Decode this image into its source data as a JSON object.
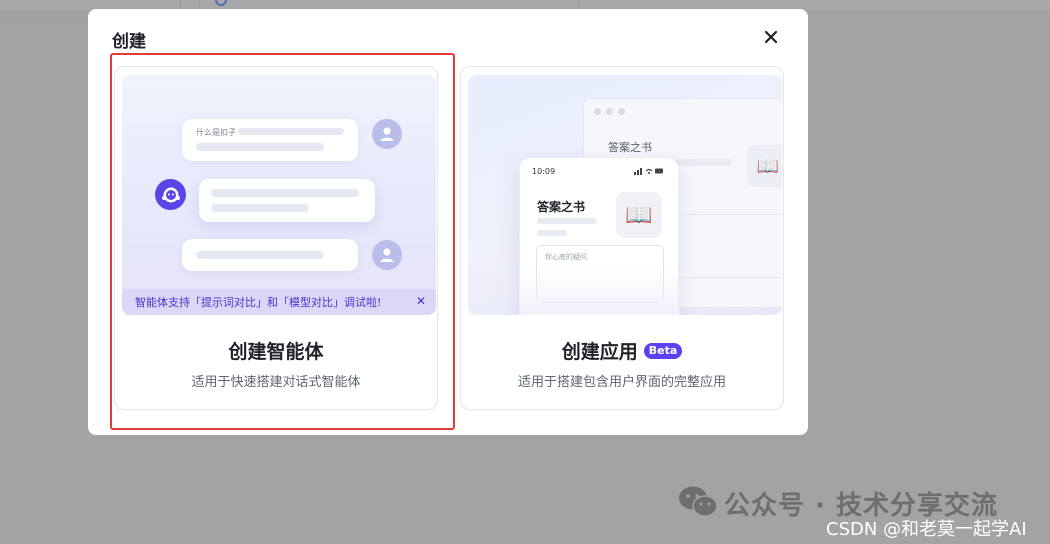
{
  "dialog": {
    "title": "创建",
    "close_glyph": "✕"
  },
  "agent_card": {
    "name": "创建智能体",
    "description": "适用于快速搭建对话式智能体",
    "illustration": {
      "prompt_text": "什么是扣子",
      "notice": "智能体支持「提示词对比」和「模型对比」调试啦!",
      "notice_close": "✕"
    }
  },
  "app_card": {
    "name": "创建应用",
    "badge": "Beta",
    "description": "适用于搭建包含用户界面的完整应用",
    "illustration": {
      "browser_title": "答案之书",
      "phone_time": "10:09",
      "phone_title": "答案之书",
      "input_placeholder": "你心底的疑问",
      "book_glyph": "📖"
    }
  },
  "watermark": {
    "line1": "公众号 · 技术分享交流",
    "line2": "CSDN @和老莫一起学AI"
  },
  "colors": {
    "accent": "#5b3ff0",
    "selection_border": "#e53935",
    "overlay": "#a3a3a5"
  }
}
